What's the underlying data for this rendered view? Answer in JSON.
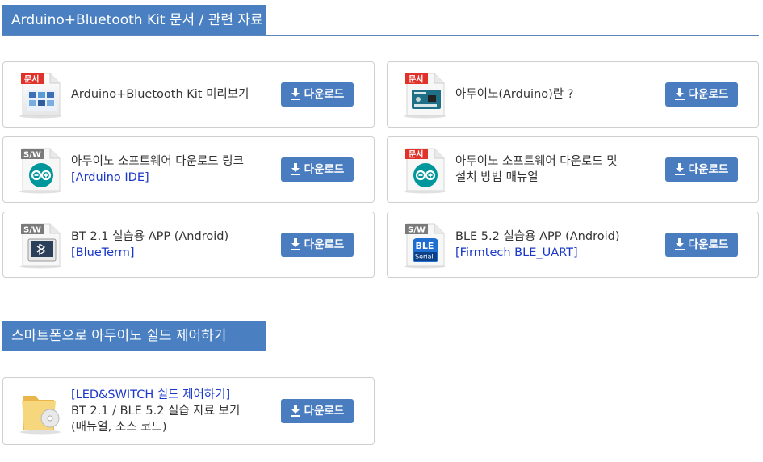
{
  "section1": {
    "title": "Arduino+Bluetooth Kit 문서 / 관련 자료",
    "cards": [
      {
        "line1": "Arduino+Bluetooth Kit 미리보기",
        "line2": "",
        "line3": "",
        "badge": "문서",
        "button": "다운로드",
        "icon": "document-kit-icon"
      },
      {
        "line1": "아두이노(Arduino)란 ?",
        "line2": "",
        "line3": "",
        "badge": "문서",
        "button": "다운로드",
        "icon": "document-arduino-icon"
      },
      {
        "line1": "아두이노 소프트웨어 다운로드 링크",
        "line2": "[Arduino IDE]",
        "line3": "",
        "badge": "S/W",
        "button": "다운로드",
        "icon": "arduino-ide-icon"
      },
      {
        "line1": "아두이노 소프트웨어 다운로드 및",
        "line2": "설치 방법 매뉴얼",
        "line3": "",
        "badge": "문서",
        "button": "다운로드",
        "icon": "arduino-manual-icon"
      },
      {
        "line1": "BT 2.1 실습용 APP (Android)",
        "line2": "[BlueTerm]",
        "line3": "",
        "badge": "S/W",
        "button": "다운로드",
        "icon": "bluetooth-terminal-icon"
      },
      {
        "line1": "BLE 5.2 실습용 APP (Android)",
        "line2": "[Firmtech BLE_UART]",
        "line3": "",
        "badge": "S/W",
        "button": "다운로드",
        "icon": "ble-serial-icon"
      }
    ]
  },
  "section2": {
    "title": "스마트폰으로 아두이노 쉴드 제어하기",
    "cards": [
      {
        "line1": "[LED&SWITCH 쉴드 제어하기]",
        "line2": "BT 2.1 / BLE 5.2 실습 자료 보기",
        "line3": "(매뉴얼, 소스 코드)",
        "button": "다운로드",
        "icon": "folder-disc-icon"
      }
    ]
  },
  "ble_label": "BLE",
  "ble_sub": "Serial",
  "colors": {
    "accent": "#4a80c2",
    "button": "#4a7cc0",
    "link": "#1a37c9",
    "badge_doc": "#e0312b",
    "badge_sw": "#777777"
  }
}
